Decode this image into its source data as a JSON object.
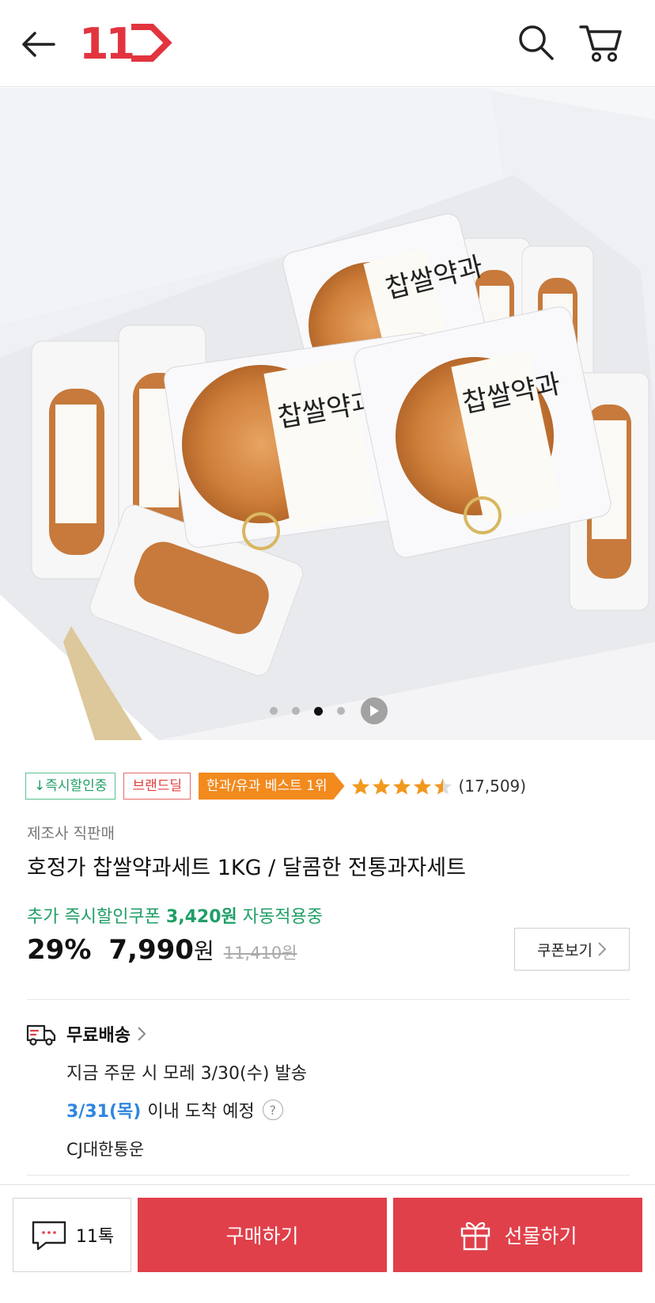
{
  "header": {
    "logo_text": "11",
    "back_icon": "arrow-left-icon",
    "search_icon": "search-icon",
    "cart_icon": "cart-icon"
  },
  "gallery": {
    "dot_count": 4,
    "active_index": 2,
    "package_label_1": "찹쌀약과",
    "package_label_2": "찹쌀약과",
    "package_label_3": "찹쌀약과"
  },
  "badges": {
    "instant_discount": "↓즉시할인중",
    "brand_deal": "브랜드딜",
    "best": "한과/유과 베스트 1위"
  },
  "rating": {
    "stars": 4.5,
    "review_count": "(17,509)"
  },
  "product": {
    "seller": "제조사 직판매",
    "title": "호정가 찹쌀약과세트 1KG / 달콤한 전통과자세트"
  },
  "coupon": {
    "prefix": "추가 즉시할인쿠폰 ",
    "amount": "3,420원",
    "suffix": " 자동적용중"
  },
  "price": {
    "discount": "29%",
    "amount": "7,990",
    "unit": "원",
    "original": "11,410원"
  },
  "coupon_button": {
    "label": "쿠폰보기"
  },
  "shipping": {
    "title": "무료배송",
    "line1": "지금 주문 시 모레 3/30(수) 발송",
    "arrival_date": "3/31(목)",
    "arrival_suffix": "이내 도착 예정",
    "carrier": "CJ대한통운"
  },
  "bottom": {
    "talk_label": "11톡",
    "buy_label": "구매하기",
    "gift_label": "선물하기"
  },
  "colors": {
    "brand_red": "#e0404a",
    "best_orange": "#f28a1e",
    "discount_green": "#1f9e66",
    "arrival_blue": "#2f86e0",
    "star_orange": "#f2991e"
  }
}
